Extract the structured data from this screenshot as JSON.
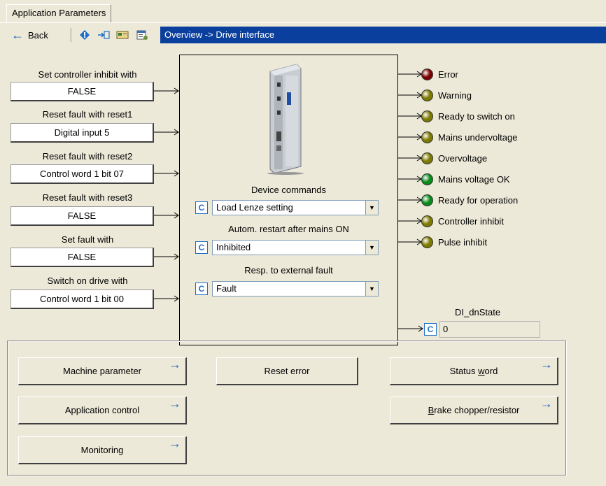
{
  "tab": {
    "label": "Application Parameters"
  },
  "toolbar": {
    "back_label": "Back",
    "breadcrumb": "Overview -> Drive interface",
    "icons": [
      "info-icon",
      "import-icon",
      "card-icon",
      "properties-icon"
    ]
  },
  "inputs": [
    {
      "label": "Set controller inhibit with",
      "value": "FALSE"
    },
    {
      "label": "Reset fault with reset1",
      "value": "Digital input 5"
    },
    {
      "label": "Reset fault with reset2",
      "value": "Control word 1 bit 07"
    },
    {
      "label": "Reset fault with reset3",
      "value": "FALSE"
    },
    {
      "label": "Set fault with",
      "value": "FALSE"
    },
    {
      "label": "Switch on drive with",
      "value": "Control word 1 bit 00"
    }
  ],
  "center": {
    "device_commands_label": "Device commands",
    "device_commands_value": "Load Lenze setting",
    "autorestart_label": "Autom. restart after mains ON",
    "autorestart_value": "Inhibited",
    "ext_fault_label": "Resp. to external fault",
    "ext_fault_value": "Fault",
    "c_label": "C"
  },
  "statuses": [
    {
      "label": "Error",
      "color": "#7a0000"
    },
    {
      "label": "Warning",
      "color": "#7d7a00"
    },
    {
      "label": "Ready to switch on",
      "color": "#7d7a00"
    },
    {
      "label": "Mains undervoltage",
      "color": "#7d7a00"
    },
    {
      "label": "Overvoltage",
      "color": "#7d7a00"
    },
    {
      "label": "Mains voltage OK",
      "color": "#0a8a1a"
    },
    {
      "label": "Ready for operation",
      "color": "#0a8a1a"
    },
    {
      "label": "Controller inhibit",
      "color": "#7d7a00"
    },
    {
      "label": "Pulse inhibit",
      "color": "#7d7a00"
    }
  ],
  "di_state": {
    "label": "DI_dnState",
    "value": "0",
    "c_label": "C"
  },
  "buttons": {
    "machine_parameter": "Machine parameter",
    "application_control": "Application control",
    "monitoring": "Monitoring",
    "reset_error": "Reset error",
    "status_word_pre": "Status ",
    "status_word_u": "w",
    "status_word_post": "ord",
    "brake_u": "B",
    "brake_post": "rake chopper/resistor"
  },
  "colors": {
    "accent_blue": "#0a3f9d",
    "arrow_blue": "#1f5ebd"
  }
}
